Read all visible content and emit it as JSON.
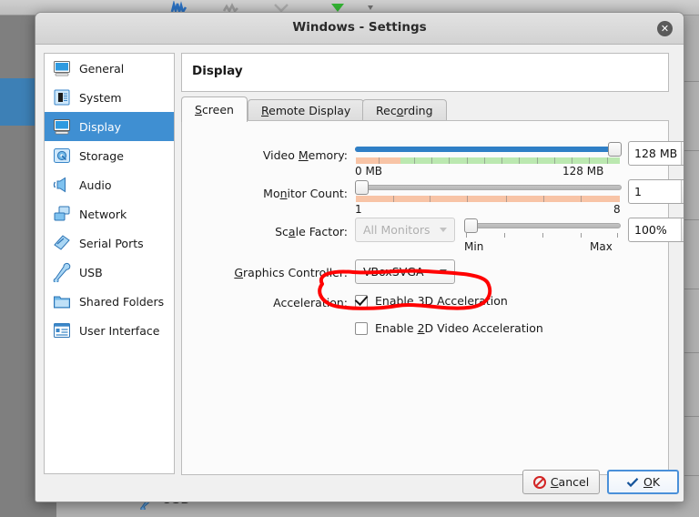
{
  "window": {
    "title": "Windows - Settings",
    "close_label": "✕"
  },
  "sidebar": {
    "items": [
      {
        "label": "General",
        "icon": "monitor-icon",
        "selected": false
      },
      {
        "label": "System",
        "icon": "chip-icon",
        "selected": false
      },
      {
        "label": "Display",
        "icon": "display-icon",
        "selected": true
      },
      {
        "label": "Storage",
        "icon": "harddisk-icon",
        "selected": false
      },
      {
        "label": "Audio",
        "icon": "speaker-icon",
        "selected": false
      },
      {
        "label": "Network",
        "icon": "network-icon",
        "selected": false
      },
      {
        "label": "Serial Ports",
        "icon": "serial-port-icon",
        "selected": false
      },
      {
        "label": "USB",
        "icon": "usb-icon",
        "selected": false
      },
      {
        "label": "Shared Folders",
        "icon": "folder-icon",
        "selected": false
      },
      {
        "label": "User Interface",
        "icon": "user-interface-icon",
        "selected": false
      }
    ]
  },
  "header": {
    "title": "Display"
  },
  "tabs": [
    {
      "label": "Screen",
      "mnemonic_index": 0,
      "active": true
    },
    {
      "label": "Remote Display",
      "mnemonic_index": 0,
      "active": false
    },
    {
      "label": "Recording",
      "mnemonic_index": 2,
      "active": false
    }
  ],
  "screen_tab": {
    "video_memory": {
      "label": "Video Memory:",
      "mnemonic_index": 6,
      "min_label": "0 MB",
      "max_label": "128 MB",
      "value": "128 MB",
      "slider_percent": 100,
      "gauge_warn_percent": 17
    },
    "monitor_count": {
      "label": "Monitor Count:",
      "mnemonic_index": 3,
      "min_label": "1",
      "max_label": "8",
      "value": "1",
      "slider_percent": 0
    },
    "scale_factor": {
      "label": "Scale Factor:",
      "mnemonic_index": 1,
      "monitor_selector": "All Monitors",
      "monitor_selector_enabled": false,
      "min_label": "Min",
      "max_label": "Max",
      "value": "100%",
      "slider_percent": 0
    },
    "graphics_controller": {
      "label": "Graphics Controller:",
      "mnemonic_index": 0,
      "value": "VBoxSVGA"
    },
    "acceleration": {
      "label": "Acceleration:",
      "options": [
        {
          "label": "Enable 3D Acceleration",
          "mnemonic_index": 7,
          "checked": true,
          "annotated": true
        },
        {
          "label": "Enable 2D Video Acceleration",
          "mnemonic_index": 7,
          "checked": false,
          "annotated": false
        }
      ]
    }
  },
  "footer": {
    "cancel_label": "Cancel",
    "cancel_mnemonic_index": 0,
    "ok_label": "OK",
    "ok_mnemonic_index": 0
  },
  "background": {
    "usb_label": "USB"
  },
  "colors": {
    "accent": "#3f8fd2",
    "slider_fill": "#2f7fc6",
    "gauge_warn": "#f8c4a6",
    "gauge_ok": "#bbe8b0",
    "annotation": "#ff0000",
    "ok_icon": "#14539a",
    "cancel_icon": "#d22424"
  }
}
